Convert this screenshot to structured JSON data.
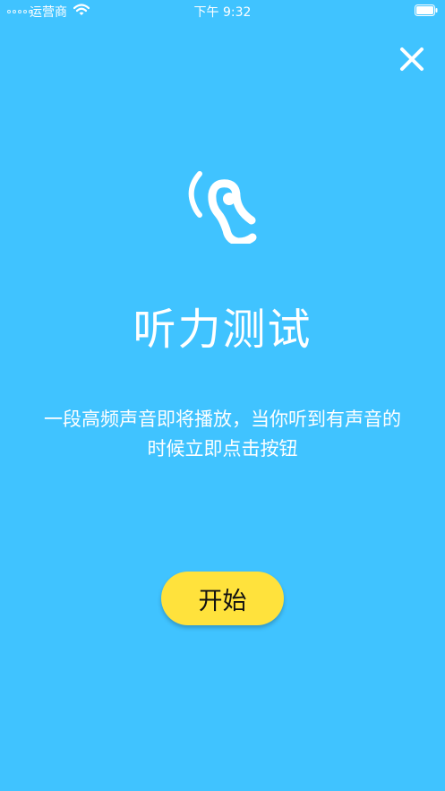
{
  "status_bar": {
    "carrier": "运营商",
    "time": "下午 9:32"
  },
  "icons": {
    "close": "close-icon",
    "ear": "ear-icon",
    "wifi": "wifi-icon",
    "battery": "battery-icon"
  },
  "main": {
    "title": "听力测试",
    "description_line1": "一段高频声音即将播放，当你听到有声音的",
    "description_line2": "时候立即点击按钮",
    "start_label": "开始"
  },
  "colors": {
    "background": "#40c3ff",
    "button": "#ffe23c",
    "text": "#ffffff"
  }
}
